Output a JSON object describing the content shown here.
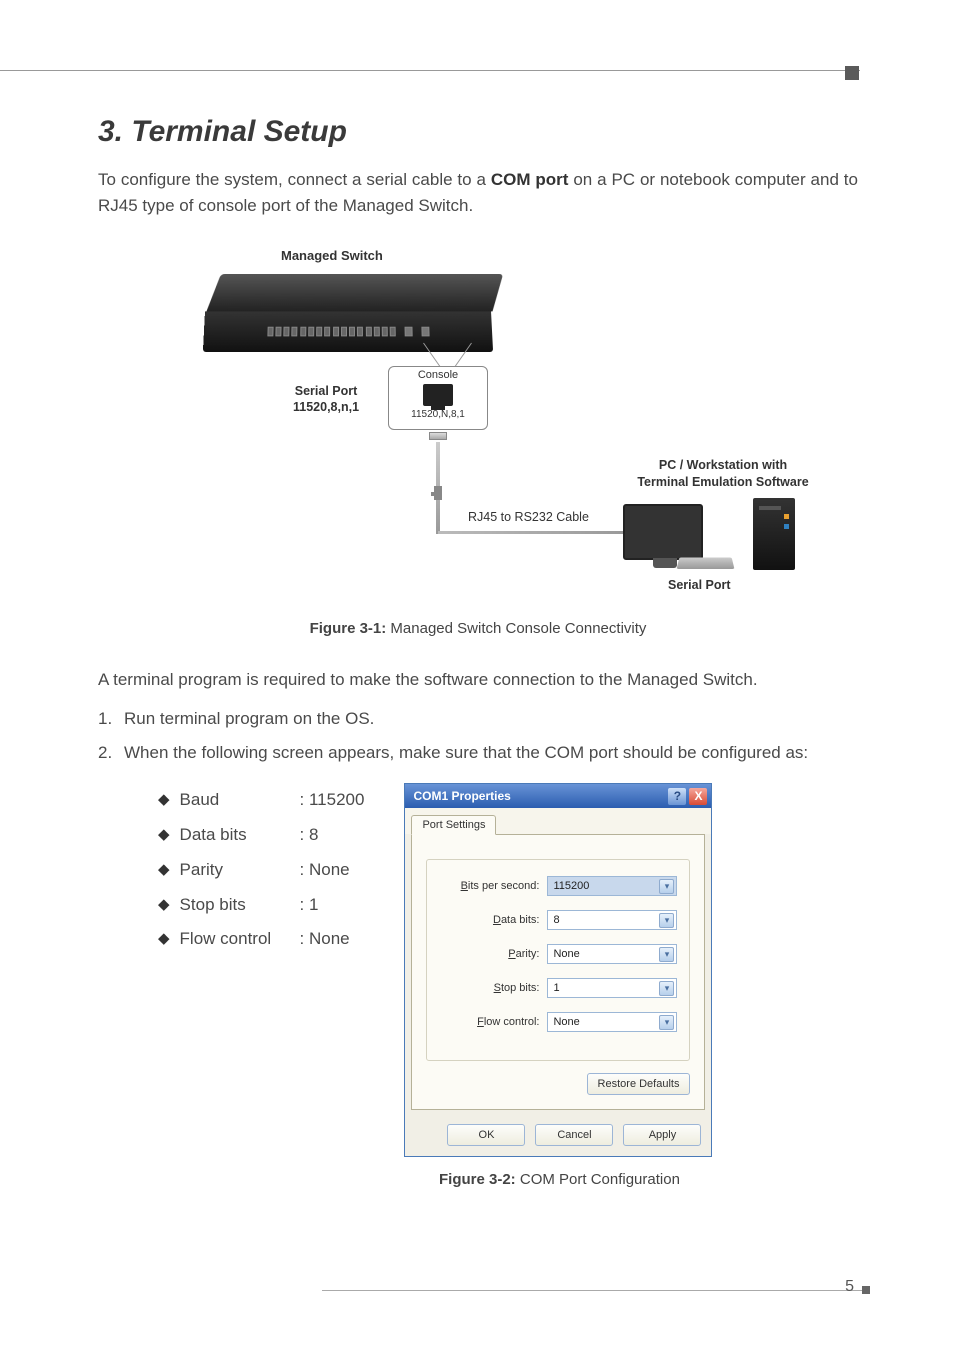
{
  "heading": "3. Terminal Setup",
  "intro_pre": "To configure the system, connect a serial cable to a ",
  "intro_bold": "COM port",
  "intro_post": " on a PC or notebook computer and to RJ45 type of console port of the Managed Switch.",
  "diagram": {
    "managed_switch": "Managed Switch",
    "serial_port_l1": "Serial Port",
    "serial_port_l2": "11520,8,n,1",
    "console": "Console",
    "console_sub": "11520,N,8,1",
    "cable_label": "RJ45 to RS232 Cable",
    "pc_l1": "PC / Workstation with",
    "pc_l2": "Terminal Emulation Software",
    "serial_port_pc": "Serial Port"
  },
  "fig1_b": "Figure 3-1:",
  "fig1_t": " Managed Switch Console Connectivity",
  "para2": "A terminal program is required to make the software connection to the Managed Switch.",
  "steps": {
    "s1_num": "1.",
    "s1": "Run terminal program on the OS.",
    "s2_num": "2.",
    "s2": "When the following screen appears, make sure that the COM port should be configured as:"
  },
  "params": [
    {
      "key": "Baud",
      "val": ": 115200"
    },
    {
      "key": "Data bits",
      "val": ": 8"
    },
    {
      "key": "Parity",
      "val": ": None"
    },
    {
      "key": "Stop bits",
      "val": ": 1"
    },
    {
      "key": "Flow control",
      "val": ": None"
    }
  ],
  "dialog": {
    "title": "COM1 Properties",
    "help": "?",
    "close": "X",
    "tab": "Port Settings",
    "fields": {
      "bits_per_second": {
        "label_u": "B",
        "label_r": "its per second:",
        "value": "115200"
      },
      "data_bits": {
        "label_u": "D",
        "label_r": "ata bits:",
        "value": "8"
      },
      "parity": {
        "label_u": "P",
        "label_r": "arity:",
        "value": "None"
      },
      "stop_bits": {
        "label_u": "S",
        "label_r": "top bits:",
        "value": "1"
      },
      "flow_control": {
        "label_u": "F",
        "label_r": "low control:",
        "value": "None"
      }
    },
    "restore_u": "R",
    "restore_r": "estore Defaults",
    "ok": "OK",
    "cancel": "Cancel",
    "apply_u": "A",
    "apply_r": "pply"
  },
  "fig2_b": "Figure 3-2:",
  "fig2_t": " COM Port Configuration",
  "page": "5"
}
